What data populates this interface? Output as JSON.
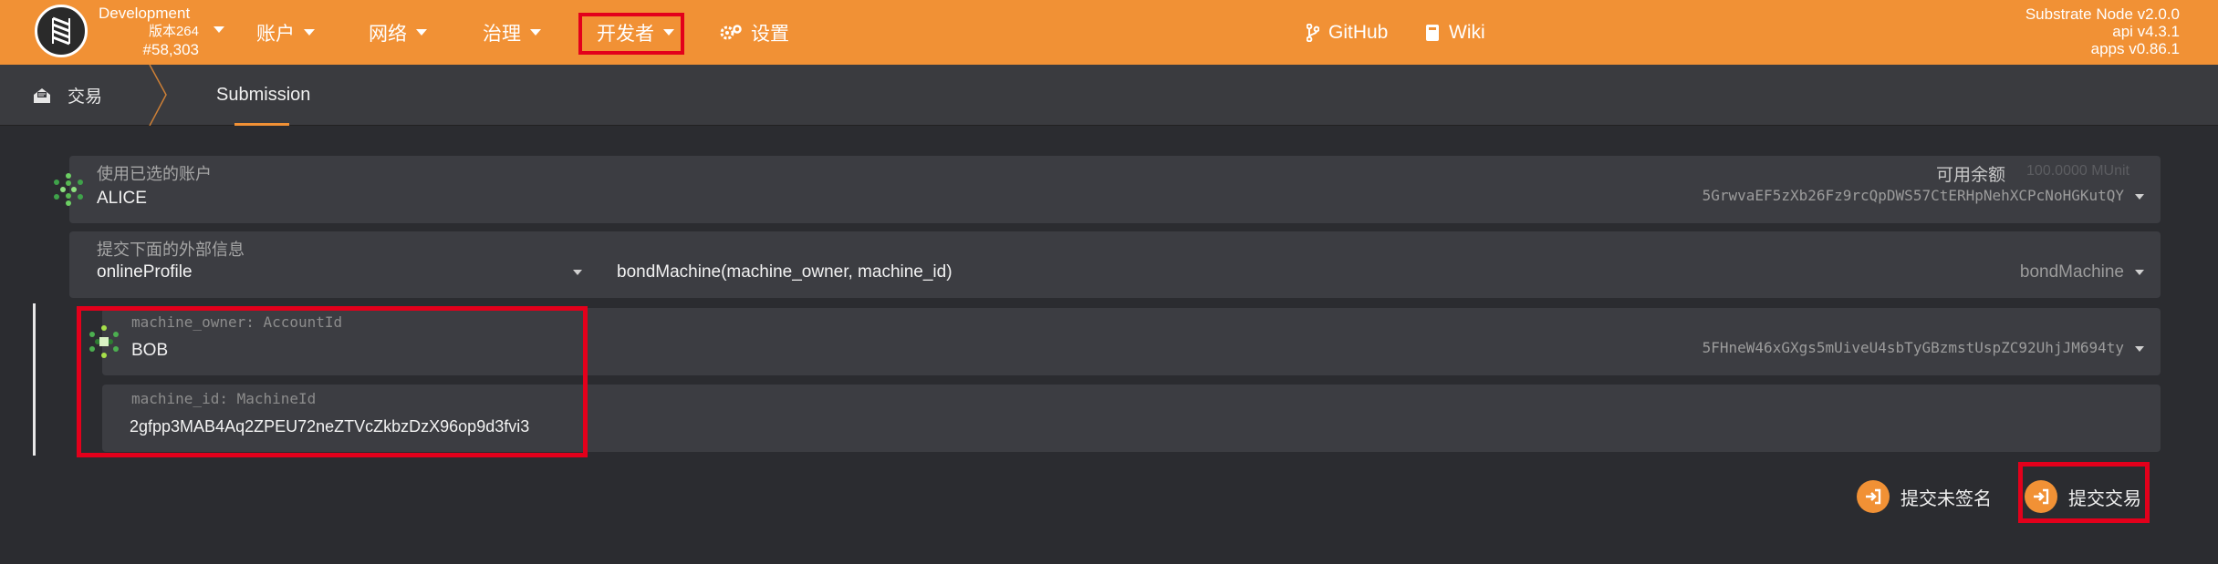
{
  "chain": {
    "name": "Development",
    "version": "版本264",
    "block": "#58,303"
  },
  "nav": {
    "items": [
      {
        "label": "账户",
        "icon": "caret-down"
      },
      {
        "label": "网络",
        "icon": "caret-down"
      },
      {
        "label": "治理",
        "icon": "caret-down"
      },
      {
        "label": "开发者",
        "icon": "caret-down"
      },
      {
        "label": "设置",
        "icon": "cogs-icon"
      }
    ],
    "links": [
      {
        "label": "GitHub",
        "icon": "code-branch-icon"
      },
      {
        "label": "Wiki",
        "icon": "book-icon"
      }
    ]
  },
  "node": {
    "name": "Substrate Node v2.0.0",
    "api": "api v4.3.1",
    "apps": "apps v0.86.1"
  },
  "breadcrumb": {
    "root": "交易",
    "active": "Submission"
  },
  "account": {
    "label": "使用已选的账户",
    "name": "ALICE",
    "address": "5GrwvaEF5zXb26Fz9rcQpDWS57CtERHpNehXCPcNoHGKutQY",
    "balance_label": "可用余额",
    "balance_value": "100.0000 MUnit"
  },
  "extrinsic": {
    "label": "提交下面的外部信息",
    "section": "onlineProfile",
    "method_signature": "bondMachine(machine_owner, machine_id)",
    "method": "bondMachine"
  },
  "params": {
    "machine_owner": {
      "label": "machine_owner: AccountId",
      "name": "BOB",
      "address": "5FHneW46xGXgs5mUiveU4sbTyGBzmstUspZC92UhjJM694ty"
    },
    "machine_id": {
      "label": "machine_id: MachineId",
      "value": "2gfpp3MAB4Aq2ZPEU72neZTVcZkbzDzX96op9d3fvi3"
    }
  },
  "actions": {
    "submit_unsigned": "提交未签名",
    "submit": "提交交易"
  },
  "colors": {
    "accent": "#f19135",
    "highlight": "#e3001b",
    "background": "#2b2c30"
  }
}
